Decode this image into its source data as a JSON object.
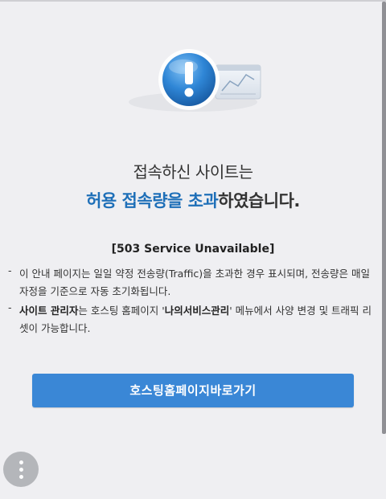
{
  "heading": {
    "line1": "접속하신 사이트는",
    "line2_accent": "허용 접속량을 초과",
    "line2_rest": "하였습니다."
  },
  "status_code": "[503 Service Unavailable]",
  "notes": [
    {
      "bold": "",
      "text": "이 안내 페이지는 일일 약정 전송량(Traffic)을 초과한 경우 표시되며, 전송량은 매일 자정을 기준으로 자동 초기화됩니다."
    },
    {
      "bold": "사이트 관리자",
      "text_a": "는 호스팅 홈페이지 '",
      "bold2": "나의서비스관리",
      "text_b": "' 메뉴에서 사양 변경 및 트래픽 리셋이 가능합니다."
    }
  ],
  "note_bullet": "-",
  "button": {
    "label": "호스팅홈페이지바로가기"
  },
  "colors": {
    "accent": "#1e6fb8",
    "button_bg": "#3a87d6",
    "background": "#efeff2"
  },
  "icons": {
    "hero": "exclamation-circle-icon",
    "monitor": "traffic-graph-icon",
    "menu": "more-vertical-icon"
  }
}
